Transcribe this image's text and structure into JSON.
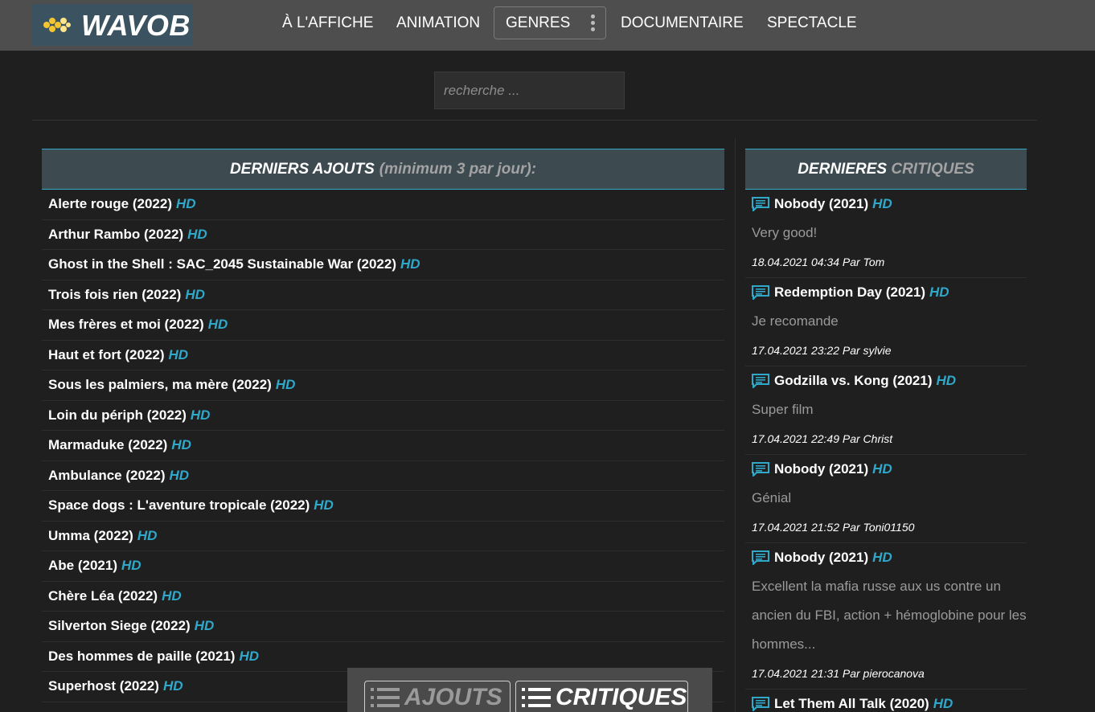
{
  "header": {
    "logo_text": "WAVOB",
    "nav": [
      "À L'AFFICHE",
      "ANIMATION",
      "GENRES",
      "DOCUMENTAIRE",
      "SPECTACLE"
    ]
  },
  "search": {
    "placeholder": "recherche ..."
  },
  "left_panel": {
    "title_main": "DERNIERS AJOUTS",
    "title_sub": "(minimum 3 par jour):",
    "items": [
      {
        "title": "Alerte rouge (2022)",
        "badge": "HD"
      },
      {
        "title": "Arthur Rambo (2022)",
        "badge": "HD"
      },
      {
        "title": "Ghost in the Shell : SAC_2045 Sustainable War (2022)",
        "badge": "HD"
      },
      {
        "title": "Trois fois rien (2022)",
        "badge": "HD"
      },
      {
        "title": "Mes frères et moi (2022)",
        "badge": "HD"
      },
      {
        "title": "Haut et fort (2022)",
        "badge": "HD"
      },
      {
        "title": "Sous les palmiers, ma mère (2022)",
        "badge": "HD"
      },
      {
        "title": "Loin du périph (2022)",
        "badge": "HD"
      },
      {
        "title": "Marmaduke (2022)",
        "badge": "HD"
      },
      {
        "title": "Ambulance (2022)",
        "badge": "HD"
      },
      {
        "title": "Space dogs : L'aventure tropicale (2022)",
        "badge": "HD"
      },
      {
        "title": "Umma (2022)",
        "badge": "HD"
      },
      {
        "title": "Abe (2021)",
        "badge": "HD"
      },
      {
        "title": "Chère Léa (2022)",
        "badge": "HD"
      },
      {
        "title": "Silverton Siege (2022)",
        "badge": "HD"
      },
      {
        "title": "Des hommes de paille (2021)",
        "badge": "HD"
      },
      {
        "title": "Superhost (2022)",
        "badge": "HD"
      }
    ]
  },
  "right_panel": {
    "title_main": "DERNIERES",
    "title_sub": "CRITIQUES",
    "reviews": [
      {
        "title": "Nobody (2021)",
        "badge": "HD",
        "text": "Very good!",
        "meta": "18.04.2021 04:34 Par Tom"
      },
      {
        "title": "Redemption Day (2021)",
        "badge": "HD",
        "text": "Je recomande",
        "meta": "17.04.2021 23:22 Par sylvie"
      },
      {
        "title": "Godzilla vs. Kong (2021)",
        "badge": "HD",
        "text": "Super film",
        "meta": "17.04.2021 22:49 Par Christ"
      },
      {
        "title": "Nobody (2021)",
        "badge": "HD",
        "text": "Génial",
        "meta": "17.04.2021 21:52 Par Toni01150"
      },
      {
        "title": "Nobody (2021)",
        "badge": "HD",
        "text": "Excellent la mafia russe aux us contre un ancien du FBI, action + hémoglobine pour les hommes...",
        "meta": "17.04.2021 21:31 Par pierocanova"
      },
      {
        "title": "Let Them All Talk (2020)",
        "badge": "HD",
        "text": "",
        "meta": ""
      }
    ]
  },
  "bottom_bar": {
    "ajouts_label": "AJOUTS",
    "critiques_label": "CRITIQUES"
  },
  "colors": {
    "accent": "#2fa8ca",
    "header_bg": "#4e4e4e",
    "page_bg": "#1f1f1f",
    "panel_head_bg": "#3d4a50"
  },
  "icons": {
    "review": "comment-icon",
    "list": "list-icon",
    "menu": "kebab-menu-icon"
  }
}
